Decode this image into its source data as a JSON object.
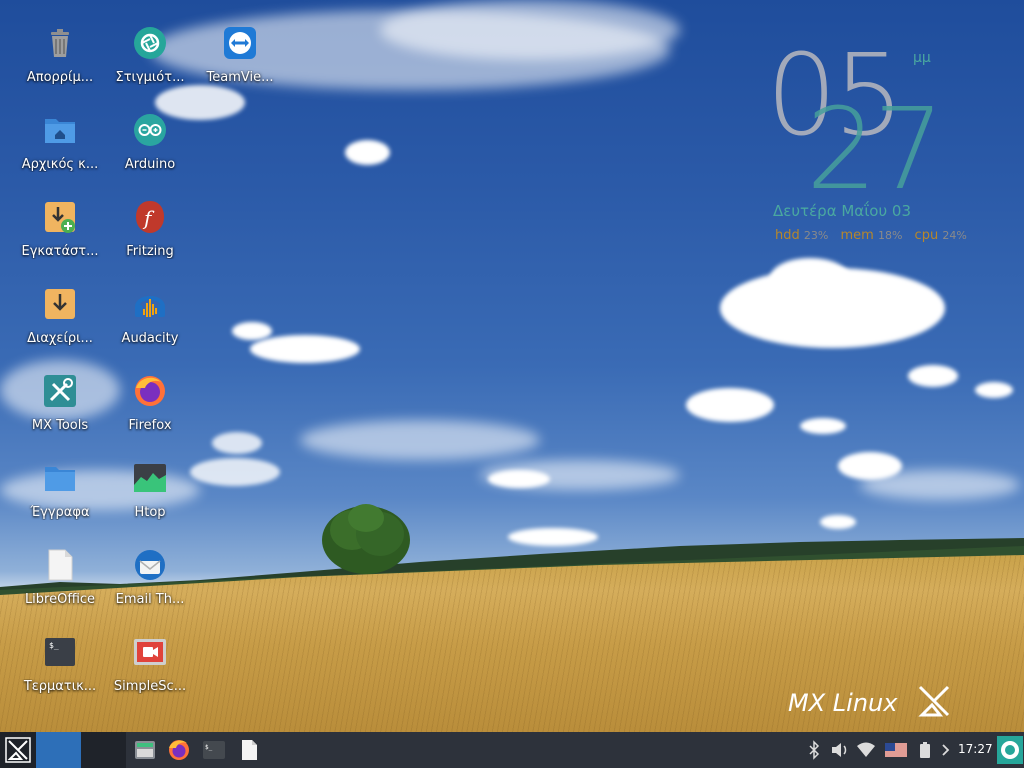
{
  "desktop": {
    "icons": [
      {
        "label": "Απορρίμ...",
        "icon": "trash-icon"
      },
      {
        "label": "Στιγμιότ...",
        "icon": "screenshot-icon"
      },
      {
        "label": "TeamVie...",
        "icon": "teamviewer-icon"
      },
      {
        "label": "Αρχικός κ...",
        "icon": "home-folder-icon"
      },
      {
        "label": "Arduino",
        "icon": "arduino-icon"
      },
      {
        "label": "Εγκατάστ...",
        "icon": "installer-icon"
      },
      {
        "label": "Fritzing",
        "icon": "fritzing-icon"
      },
      {
        "label": "Διαχείρι...",
        "icon": "package-manager-icon"
      },
      {
        "label": "Audacity",
        "icon": "audacity-icon"
      },
      {
        "label": "MX Tools",
        "icon": "mx-tools-icon"
      },
      {
        "label": "Firefox",
        "icon": "firefox-icon"
      },
      {
        "label": "Έγγραφα",
        "icon": "documents-folder-icon"
      },
      {
        "label": "Htop",
        "icon": "htop-icon"
      },
      {
        "label": "LibreOffice",
        "icon": "libreoffice-icon"
      },
      {
        "label": "Email Th...",
        "icon": "thunderbird-icon"
      },
      {
        "label": "Τερματικ...",
        "icon": "terminal-icon"
      },
      {
        "label": "SimpleSc...",
        "icon": "simplescreenrecorder-icon"
      }
    ]
  },
  "conky": {
    "hour": "05",
    "minute": "27",
    "ampm": "μμ",
    "date": "Δευτέρα   Μαΐου 03",
    "stats": [
      {
        "key": "hdd",
        "value": "23%"
      },
      {
        "key": "mem",
        "value": "18%"
      },
      {
        "key": "cpu",
        "value": "24%"
      }
    ]
  },
  "branding": {
    "logo_text": "MX Linux"
  },
  "taskbar": {
    "launchers": [
      "file-manager-icon",
      "firefox-icon",
      "terminal-icon",
      "document-icon"
    ],
    "tray": [
      "bluetooth-icon",
      "volume-icon",
      "wifi-icon",
      "us-flag-icon",
      "battery-icon",
      "chevron-right-icon"
    ],
    "clock": "17:27"
  },
  "colors": {
    "taskbar": "#2d323b",
    "active_workspace": "#2d6fb8",
    "conky_teal": "#4aa8a0",
    "conky_gold": "#b7872a"
  }
}
